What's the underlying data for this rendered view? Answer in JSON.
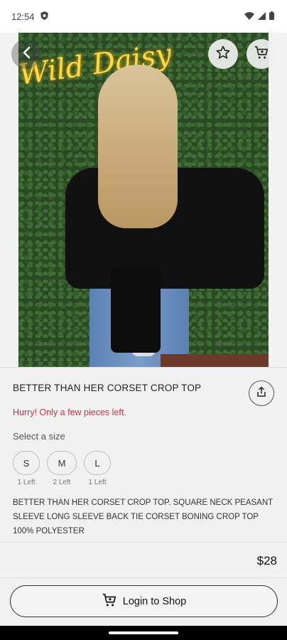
{
  "status_bar": {
    "time": "12:54",
    "icons": [
      "shield-notification-icon",
      "wifi-icon",
      "signal-icon",
      "battery-icon"
    ]
  },
  "hero": {
    "neon_sign_text": "Wild Daisy",
    "carousel_dots": 2,
    "active_dot": 1,
    "buttons": [
      "back-icon",
      "star-icon",
      "cart-icon"
    ]
  },
  "product": {
    "title": "BETTER THAN HER CORSET CROP TOP",
    "stock_warning": "Hurry! Only a few pieces left.",
    "size_prompt": "Select a size",
    "sizes": [
      {
        "label": "S",
        "stock": "1 Left"
      },
      {
        "label": "M",
        "stock": "2 Left"
      },
      {
        "label": "L",
        "stock": "1 Left"
      }
    ],
    "description": "BETTER THAN HER CORSET CROP TOP. SQUARE NECK PEASANT SLEEVE LONG SLEEVE BACK TIE CORSET BONING CROP TOP 100% POLYESTER",
    "price": "$28"
  },
  "actions": {
    "login_label": "Login to Shop"
  },
  "colors": {
    "warning": "#c8344a",
    "background": "#f1f1f1",
    "text": "#222222"
  }
}
